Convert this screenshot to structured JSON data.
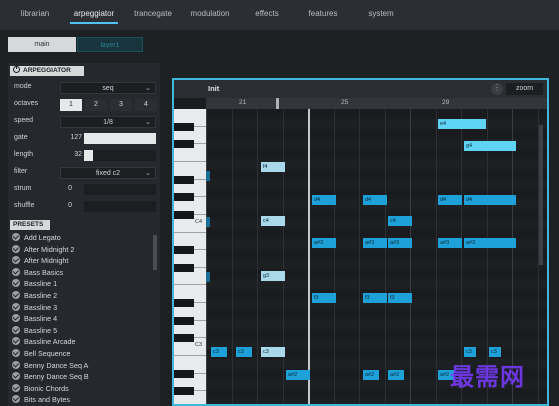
{
  "top_tabs": [
    "librarian",
    "arpeggiator",
    "trancegate",
    "modulation",
    "effects",
    "features",
    "system"
  ],
  "active_top_tab": "arpeggiator",
  "sub_tabs": {
    "main": "main",
    "layer": "layer1"
  },
  "arpeggiator": {
    "title": "ARPEGGIATOR",
    "mode_label": "mode",
    "mode_value": "seq",
    "octaves_label": "octaves",
    "octave_options": [
      "1",
      "2",
      "3",
      "4"
    ],
    "octave_selected": "1",
    "speed_label": "speed",
    "speed_value": "1/8",
    "gate_label": "gate",
    "gate_value": "127",
    "gate_fraction": 1.0,
    "length_label": "length",
    "length_value": "32",
    "length_fraction": 0.12,
    "filter_label": "filter",
    "filter_value": "fixed c2",
    "strum_label": "strum",
    "strum_value": "0",
    "shuffle_label": "shuffle",
    "shuffle_value": "0"
  },
  "presets": {
    "title": "PRESETS",
    "items": [
      "Add Legato",
      "After Midnight 2",
      "After Midnight",
      "Bass Basics",
      "Bassline 1",
      "Bassline 2",
      "Bassline 3",
      "Bassline 4",
      "Bassline 5",
      "Bassline Arcade",
      "Bell Sequence",
      "Benny Dance Seq A",
      "Benny Dance Seq B",
      "Bionic Chords",
      "Bits and Bytes"
    ]
  },
  "editor": {
    "title": "Init",
    "zoom_label": "zoom",
    "menu_glyph": "⋮",
    "ruler": [
      "21",
      "25",
      "29"
    ],
    "key_labels": [
      "C4",
      "C3"
    ]
  },
  "notes": [
    {
      "label": "e4",
      "style": "bright"
    },
    {
      "label": "g4",
      "style": "bright"
    },
    {
      "label": "f4",
      "style": "sel"
    },
    {
      "label": "d4",
      "style": "normal"
    },
    {
      "label": "d4",
      "style": "normal"
    },
    {
      "label": "d4",
      "style": "normal"
    },
    {
      "label": "d4",
      "style": "normal"
    },
    {
      "label": "c4",
      "style": "sel"
    },
    {
      "label": "c4",
      "style": "normal"
    },
    {
      "label": "a#3",
      "style": "normal"
    },
    {
      "label": "a#3",
      "style": "normal"
    },
    {
      "label": "a#3",
      "style": "normal"
    },
    {
      "label": "a#3",
      "style": "normal"
    },
    {
      "label": "a#3",
      "style": "normal"
    },
    {
      "label": "g3",
      "style": "sel"
    },
    {
      "label": "f3",
      "style": "normal"
    },
    {
      "label": "f3",
      "style": "normal"
    },
    {
      "label": "f3",
      "style": "normal"
    },
    {
      "label": "c3",
      "style": "normal"
    },
    {
      "label": "c3",
      "style": "normal"
    },
    {
      "label": "c3",
      "style": "sel"
    },
    {
      "label": "c3",
      "style": "normal"
    },
    {
      "label": "c3",
      "style": "normal"
    },
    {
      "label": "a#2",
      "style": "normal"
    },
    {
      "label": "a#2",
      "style": "normal"
    },
    {
      "label": "a#2",
      "style": "normal"
    },
    {
      "label": "a#2",
      "style": "normal"
    }
  ],
  "watermark": "最需网",
  "colors": {
    "accent": "#3fb8dc",
    "note": "#1ea0d8",
    "note_bright": "#5fd3f5",
    "note_selected": "#a9d8ea"
  }
}
